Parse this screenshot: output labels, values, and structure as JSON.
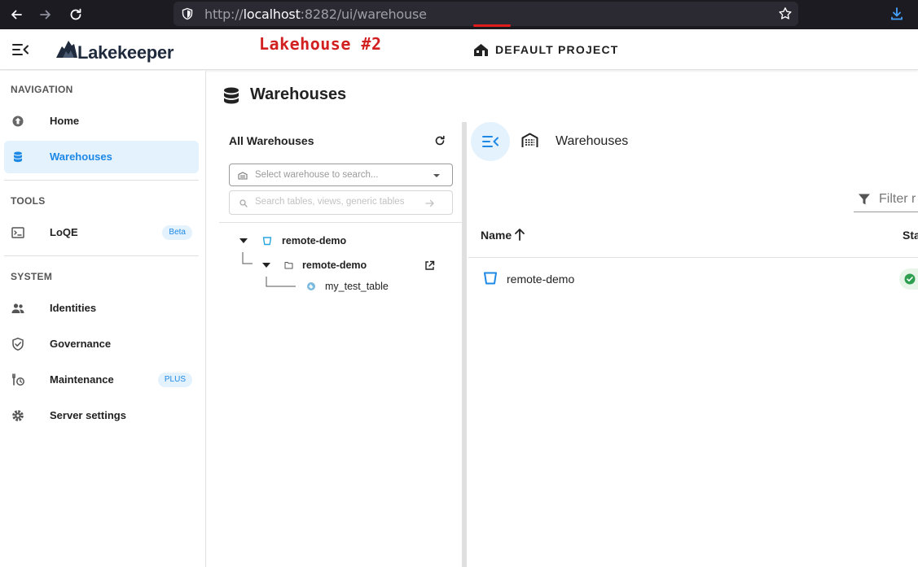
{
  "browser": {
    "url_scheme": "http://",
    "url_host": "localhost",
    "url_rest": ":8282/ui/warehouse"
  },
  "header": {
    "logo": "Lakekeeper",
    "annotation": "Lakehouse #2",
    "project": "DEFAULT PROJECT"
  },
  "sidebar": {
    "navigation_label": "NAVIGATION",
    "tools_label": "TOOLS",
    "system_label": "SYSTEM",
    "items": {
      "home": "Home",
      "warehouses": "Warehouses",
      "loqe": "LoQE",
      "loqe_badge": "Beta",
      "identities": "Identities",
      "governance": "Governance",
      "maintenance": "Maintenance",
      "maintenance_badge": "PLUS",
      "server_settings": "Server settings"
    }
  },
  "main": {
    "title": "Warehouses"
  },
  "tree": {
    "title": "All Warehouses",
    "select_placeholder": "Select warehouse to search...",
    "search_placeholder": "Search tables, views, generic tables",
    "warehouse": "remote-demo",
    "namespace": "remote-demo",
    "table": "my_test_table"
  },
  "right": {
    "title": "Warehouses",
    "filter_placeholder": "Filter r",
    "col_name": "Name",
    "col_status": "Sta",
    "rows": [
      {
        "name": "remote-demo"
      }
    ]
  },
  "colors": {
    "accent": "#1e88e5",
    "annotation": "#d21f1f",
    "active_bg": "#e3f2fd",
    "status_ok": "#2e9e4f"
  }
}
